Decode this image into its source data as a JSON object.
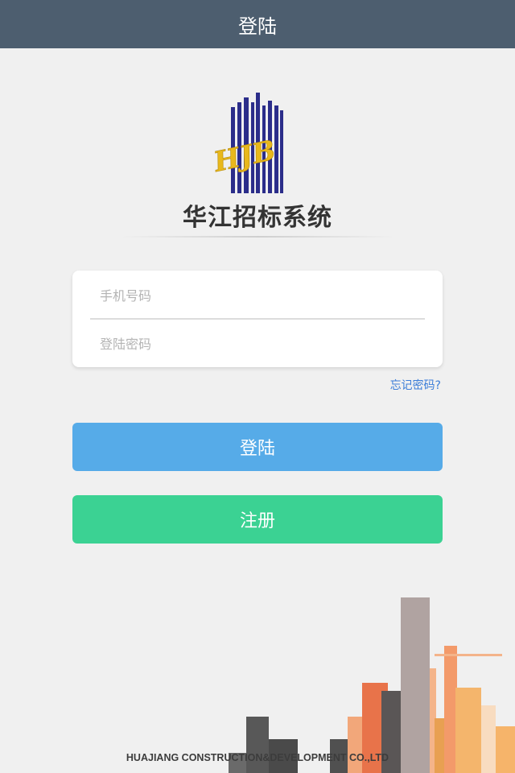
{
  "header": {
    "title": "登陆"
  },
  "logo": {
    "monogram": "HJB",
    "app_name": "华江招标系统"
  },
  "form": {
    "phone_placeholder": "手机号码",
    "password_placeholder": "登陆密码",
    "forgot_label": "忘记密码?"
  },
  "buttons": {
    "login_label": "登陆",
    "register_label": "注册"
  },
  "footer": {
    "company": "HUAJIANG CONSTRUCTION&DEVELOPMENT CO.,LTD"
  },
  "colors": {
    "header_bg": "#4d5e6f",
    "login": "#56abe8",
    "register": "#3bd293",
    "link": "#3b7dd8",
    "logo_blue": "#2b2d8a",
    "logo_gold": "#e8b81c"
  }
}
